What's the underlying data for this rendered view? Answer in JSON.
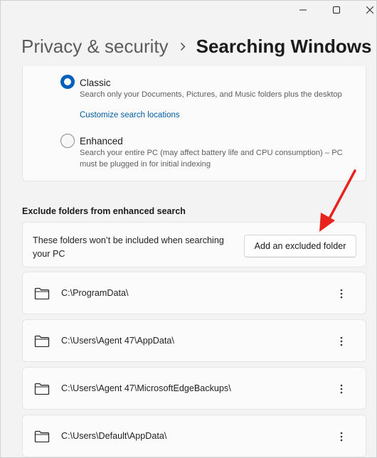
{
  "window": {
    "controls": {
      "minimize_icon": "minimize-icon",
      "maximize_icon": "maximize-icon",
      "close_icon": "close-icon"
    }
  },
  "breadcrumb": {
    "parent": "Privacy & security",
    "separator_icon": "chevron-right-icon",
    "current": "Searching Windows"
  },
  "search_mode": {
    "classic": {
      "title": "Classic",
      "description": "Search only your Documents, Pictures, and Music folders plus the desktop",
      "link": "Customize search locations",
      "selected": true
    },
    "enhanced": {
      "title": "Enhanced",
      "description": "Search your entire PC (may affect battery life and CPU consumption) – PC must be plugged in for initial indexing",
      "selected": false
    }
  },
  "exclude": {
    "header": "Exclude folders from enhanced search",
    "info": "These folders won’t be included when searching your PC",
    "add_button": "Add an excluded folder",
    "folders": [
      {
        "path": "C:\\ProgramData\\"
      },
      {
        "path": "C:\\Users\\Agent 47\\AppData\\"
      },
      {
        "path": "C:\\Users\\Agent 47\\MicrosoftEdgeBackups\\"
      },
      {
        "path": "C:\\Users\\Default\\AppData\\"
      }
    ]
  },
  "colors": {
    "accent": "#005fb8",
    "link": "#005a9e",
    "annotation_arrow": "#e8231e",
    "background": "#f3f3f3",
    "card": "#fbfbfb"
  }
}
